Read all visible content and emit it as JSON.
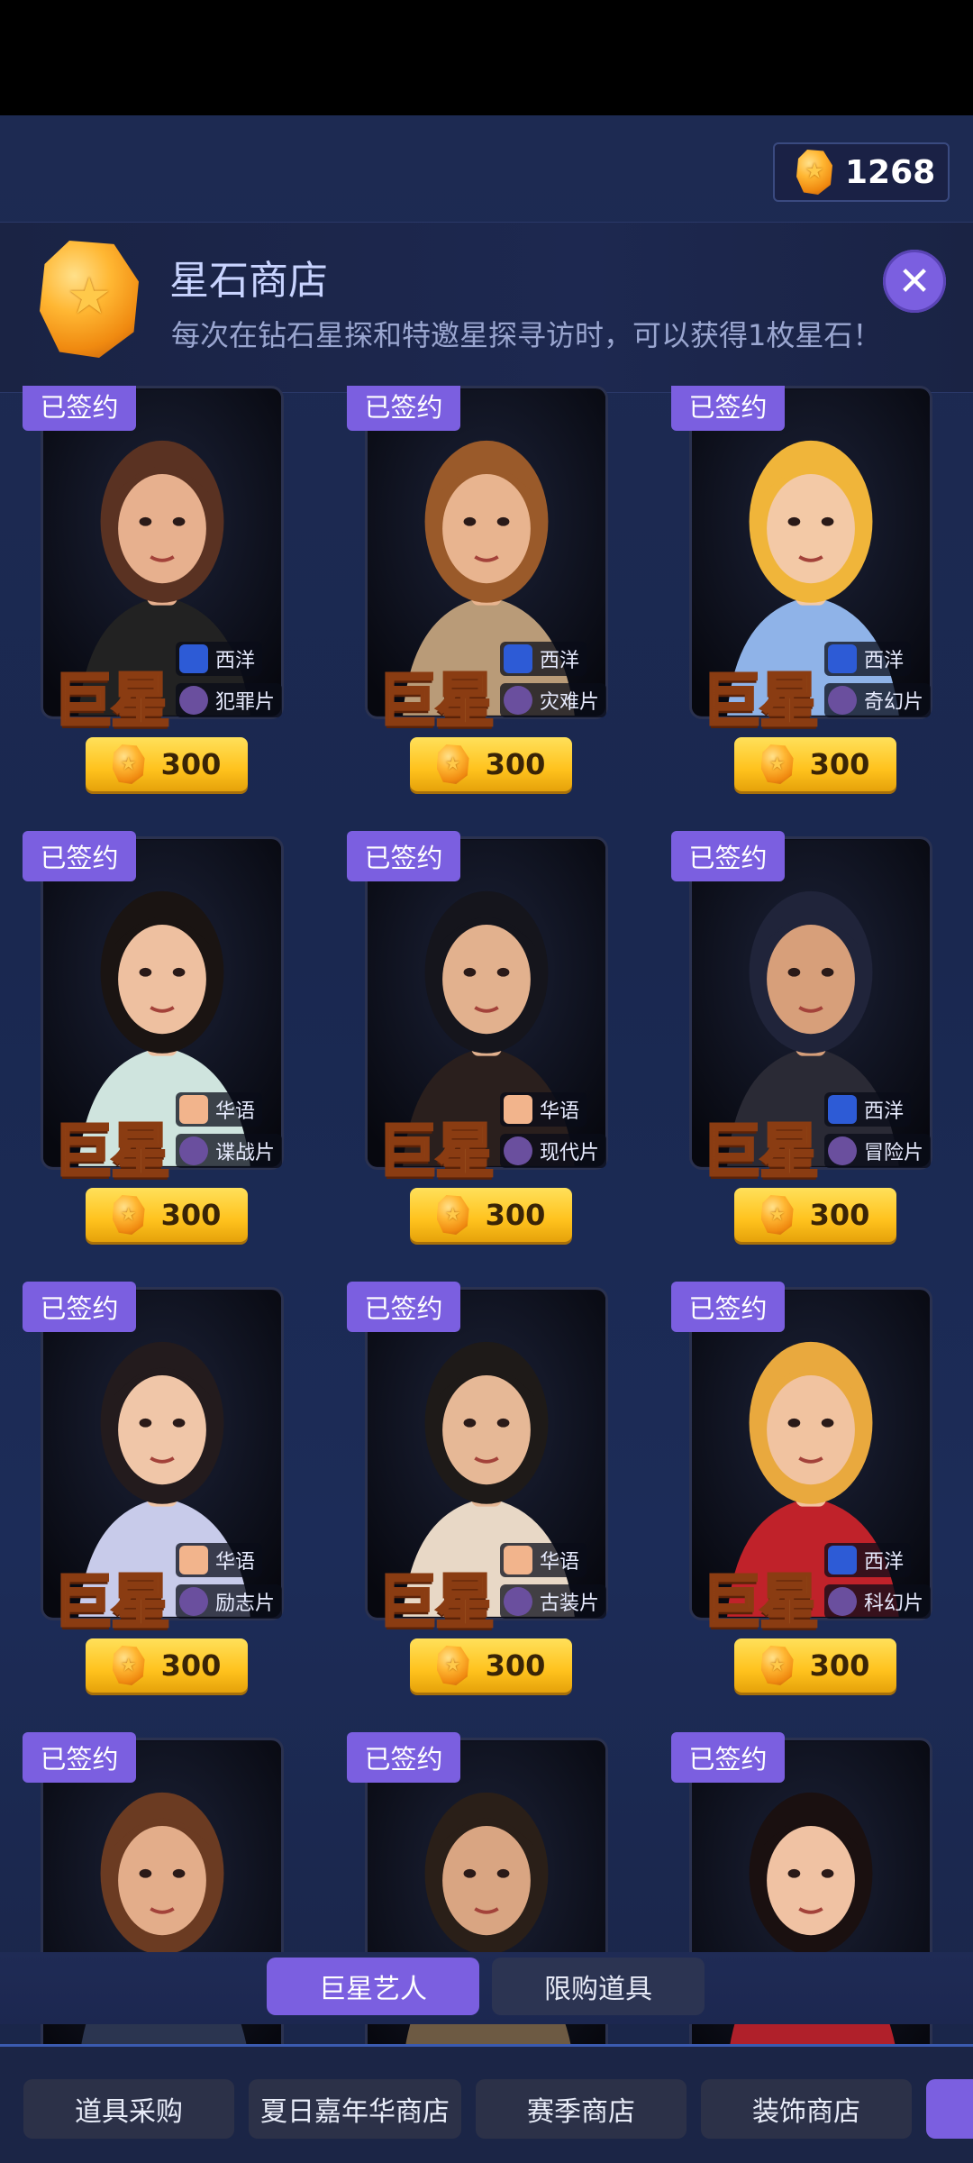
{
  "currency": {
    "icon": "star-gem-icon",
    "amount": "1268"
  },
  "header": {
    "title": "星石商店",
    "description": "每次在钻石星探和特邀星探寻访时，可以获得1枚星石！",
    "close_icon": "close-icon"
  },
  "cards": [
    {
      "badge": "已签约",
      "rank": "巨星",
      "region": "西洋",
      "genre": "犯罪片",
      "price": "300",
      "hair": "#5a3222",
      "skin": "#e7b08e",
      "outfit": "#222"
    },
    {
      "badge": "已签约",
      "rank": "巨星",
      "region": "西洋",
      "genre": "灾难片",
      "price": "300",
      "hair": "#9a5a2a",
      "skin": "#e8b48f",
      "outfit": "#b99b78"
    },
    {
      "badge": "已签约",
      "rank": "巨星",
      "region": "西洋",
      "genre": "奇幻片",
      "price": "300",
      "hair": "#f0b53a",
      "skin": "#f3c9a6",
      "outfit": "#8fb3e8"
    },
    {
      "badge": "已签约",
      "rank": "巨星",
      "region": "华语",
      "genre": "谍战片",
      "price": "300",
      "hair": "#1a1412",
      "skin": "#eec0a0",
      "outfit": "#cfe4de"
    },
    {
      "badge": "已签约",
      "rank": "巨星",
      "region": "华语",
      "genre": "现代片",
      "price": "300",
      "hair": "#15151c",
      "skin": "#e2b18e",
      "outfit": "#2a1f1d"
    },
    {
      "badge": "已签约",
      "rank": "巨星",
      "region": "西洋",
      "genre": "冒险片",
      "price": "300",
      "hair": "#20243a",
      "skin": "#d79f7a",
      "outfit": "#2a2a35"
    },
    {
      "badge": "已签约",
      "rank": "巨星",
      "region": "华语",
      "genre": "励志片",
      "price": "300",
      "hair": "#231b1d",
      "skin": "#f0c6a8",
      "outfit": "#c8cbea"
    },
    {
      "badge": "已签约",
      "rank": "巨星",
      "region": "华语",
      "genre": "古装片",
      "price": "300",
      "hair": "#1e1a18",
      "skin": "#e6b896",
      "outfit": "#e8d8c6"
    },
    {
      "badge": "已签约",
      "rank": "巨星",
      "region": "西洋",
      "genre": "科幻片",
      "price": "300",
      "hair": "#e9a93e",
      "skin": "#f1c3a0",
      "outfit": "#c0222a"
    },
    {
      "badge": "已签约",
      "hair": "#6b3b22",
      "skin": "#e3ad8a",
      "outfit": "#2b3550"
    },
    {
      "badge": "已签约",
      "hair": "#2a1f18",
      "skin": "#d9a582",
      "outfit": "#6d5a43"
    },
    {
      "badge": "已签约",
      "hair": "#1a1010",
      "skin": "#f0c2a3",
      "outfit": "#b0202a"
    }
  ],
  "tabs": {
    "active": "巨星艺人",
    "inactive": "限购道具"
  },
  "bottom_nav": [
    "道具采购",
    "夏日嘉年华商店",
    "赛季商店",
    "装饰商店"
  ]
}
